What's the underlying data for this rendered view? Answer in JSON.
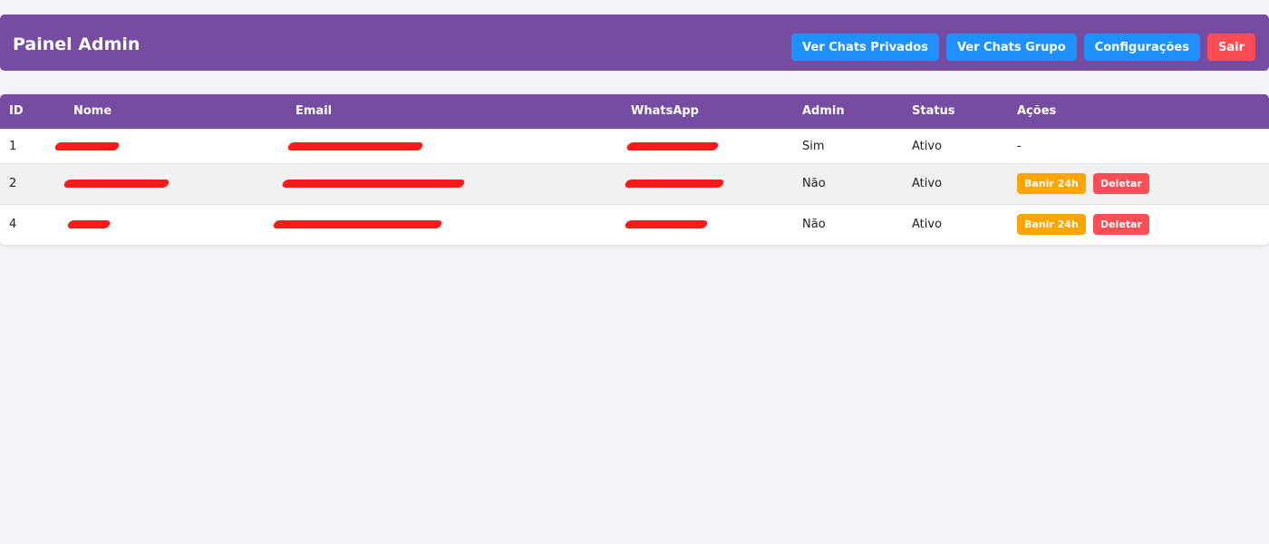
{
  "header": {
    "title": "Painel Admin",
    "buttons": {
      "private_chats": "Ver Chats Privados",
      "group_chats": "Ver Chats Grupo",
      "settings": "Configurações",
      "logout": "Sair"
    }
  },
  "table": {
    "columns": [
      "ID",
      "Nome",
      "Email",
      "WhatsApp",
      "Admin",
      "Status",
      "Ações"
    ],
    "rows": [
      {
        "id": "1",
        "admin": "Sim",
        "status": "Ativo",
        "acoes": "-"
      },
      {
        "id": "2",
        "admin": "Não",
        "status": "Ativo"
      },
      {
        "id": "4",
        "admin": "Não",
        "status": "Ativo"
      }
    ],
    "action_labels": {
      "ban": "Banir 24h",
      "delete": "Deletar"
    }
  },
  "colors": {
    "header_bg": "#764ba2",
    "primary_button": "#1e90ff",
    "danger_button": "#ff4d55",
    "warning_button": "#ffa500",
    "redaction": "#ff1a1a"
  }
}
